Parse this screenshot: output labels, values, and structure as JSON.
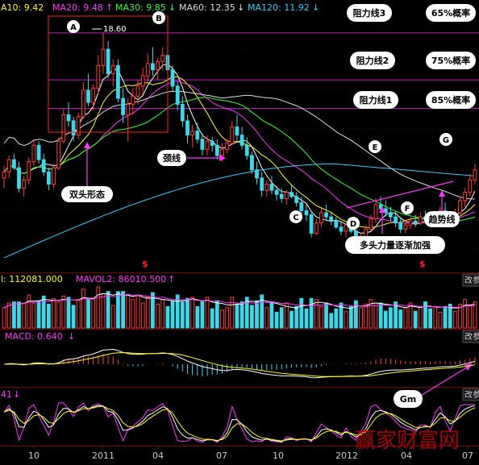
{
  "ma_header": {
    "ma10": "A10: 9.42",
    "ma20": "MA20: 9.48",
    "ma20_arrow": "↑",
    "ma30": "MA30: 9.85",
    "ma30_arrow": "↓",
    "ma60": "MA60: 12.35",
    "ma60_arrow": "↓",
    "ma120": "MA120: 11.92",
    "ma120_arrow": "↓"
  },
  "vol_header": {
    "vol": "l: 112081.000",
    "mavol2": "MAVOL2: 86010.500",
    "arrow": "↑",
    "btn": "改参"
  },
  "macd_header": {
    "macd": "MACD: 0.640",
    "arrow": "↓",
    "btn": "改参"
  },
  "kdj_header": {
    "val": "41",
    "arrow": "↓",
    "btn": "改参"
  },
  "annotations": {
    "A": "A",
    "B": "B",
    "C": "C",
    "D": "D",
    "E": "E",
    "F": "F",
    "G": "G",
    "peak_label": "18.60",
    "double_top": "双头形态",
    "neckline": "颈线",
    "trendline": "趋势线",
    "bull_strength": "多头力量逐渐加强",
    "gm": "Gm",
    "dollar1": "$",
    "dollar2": "$"
  },
  "resistance": [
    {
      "label": "阻力线3",
      "prob": "65%概率"
    },
    {
      "label": "阻力线2",
      "prob": "75%概率"
    },
    {
      "label": "阻力线1",
      "prob": "85%概率"
    }
  ],
  "x_axis": {
    "ticks": [
      "10",
      "2011",
      "04",
      "07",
      "10",
      "2012",
      "04",
      "07"
    ]
  },
  "watermark": "赢家财富网",
  "colors": {
    "up": "#ff3b3b",
    "down": "#3fd7e8",
    "ma5": "#ffffff",
    "ma10": "#ffff00",
    "ma20": "#ff33ff",
    "ma30": "#33ff33",
    "ma60": "#dddddd",
    "ma120": "#33ccff",
    "annot": "#ff33ff"
  },
  "chart_data": {
    "type": "candlestick",
    "price_panel": {
      "ylim": [
        7.2,
        19.5
      ],
      "candles": [
        [
          11.5,
          12.1,
          11.0,
          11.8
        ],
        [
          11.8,
          12.6,
          11.5,
          12.4
        ],
        [
          12.4,
          12.7,
          11.9,
          12.0
        ],
        [
          12.0,
          12.3,
          10.8,
          11.0
        ],
        [
          11.0,
          11.6,
          10.6,
          11.4
        ],
        [
          11.4,
          12.5,
          11.2,
          12.3
        ],
        [
          12.3,
          13.4,
          12.1,
          13.1
        ],
        [
          13.1,
          13.3,
          12.2,
          12.4
        ],
        [
          12.4,
          12.7,
          11.6,
          11.8
        ],
        [
          11.8,
          12.0,
          10.9,
          11.2
        ],
        [
          11.2,
          12.2,
          11.0,
          12.0
        ],
        [
          12.0,
          13.5,
          11.9,
          13.3
        ],
        [
          13.3,
          14.9,
          13.2,
          14.6
        ],
        [
          14.6,
          15.2,
          14.0,
          14.3
        ],
        [
          14.3,
          14.5,
          13.3,
          13.6
        ],
        [
          13.6,
          14.7,
          13.4,
          14.5
        ],
        [
          14.5,
          16.2,
          14.4,
          15.8
        ],
        [
          15.8,
          16.6,
          15.0,
          15.2
        ],
        [
          15.2,
          16.1,
          14.8,
          15.9
        ],
        [
          15.9,
          17.5,
          15.6,
          17.0
        ],
        [
          17.0,
          18.6,
          16.6,
          17.8
        ],
        [
          17.8,
          18.2,
          16.4,
          16.6
        ],
        [
          16.6,
          17.3,
          16.0,
          17.0
        ],
        [
          17.0,
          17.3,
          15.2,
          15.4
        ],
        [
          15.4,
          15.9,
          14.2,
          14.6
        ],
        [
          14.6,
          15.4,
          13.3,
          15.1
        ],
        [
          15.1,
          15.9,
          14.6,
          15.5
        ],
        [
          15.5,
          16.3,
          15.1,
          16.0
        ],
        [
          16.0,
          16.9,
          15.6,
          16.5
        ],
        [
          16.5,
          17.6,
          16.2,
          17.1
        ],
        [
          17.1,
          17.9,
          16.5,
          16.8
        ],
        [
          16.8,
          17.4,
          16.3,
          17.2
        ],
        [
          17.2,
          17.9,
          16.8,
          17.5
        ],
        [
          17.5,
          17.8,
          16.6,
          16.8
        ],
        [
          16.8,
          17.0,
          15.7,
          16.0
        ],
        [
          16.0,
          16.2,
          14.8,
          15.1
        ],
        [
          15.1,
          15.5,
          14.0,
          14.3
        ],
        [
          14.3,
          14.6,
          13.2,
          13.6
        ],
        [
          13.6,
          14.1,
          13.0,
          13.8
        ],
        [
          13.8,
          14.2,
          13.2,
          13.4
        ],
        [
          13.4,
          13.7,
          12.6,
          12.9
        ],
        [
          12.9,
          13.6,
          12.6,
          13.3
        ],
        [
          13.3,
          13.5,
          12.8,
          13.1
        ],
        [
          13.1,
          13.4,
          12.4,
          12.6
        ],
        [
          12.6,
          13.2,
          12.3,
          12.9
        ],
        [
          12.9,
          13.4,
          12.7,
          13.2
        ],
        [
          13.2,
          14.3,
          13.1,
          14.0
        ],
        [
          14.0,
          14.6,
          13.3,
          13.6
        ],
        [
          13.6,
          14.0,
          12.9,
          13.1
        ],
        [
          13.1,
          13.5,
          12.4,
          12.6
        ],
        [
          12.6,
          12.8,
          11.7,
          11.9
        ],
        [
          11.9,
          12.3,
          11.2,
          11.5
        ],
        [
          11.5,
          11.8,
          10.6,
          10.9
        ],
        [
          10.9,
          11.4,
          10.6,
          11.2
        ],
        [
          11.2,
          11.6,
          10.7,
          10.9
        ],
        [
          10.9,
          11.1,
          10.4,
          10.7
        ],
        [
          10.7,
          11.0,
          10.3,
          10.5
        ],
        [
          10.5,
          10.9,
          10.2,
          10.8
        ],
        [
          10.8,
          11.2,
          10.5,
          10.6
        ],
        [
          10.6,
          10.8,
          10.1,
          10.3
        ],
        [
          10.3,
          10.6,
          9.6,
          9.9
        ],
        [
          9.9,
          10.2,
          9.4,
          9.7
        ],
        [
          9.7,
          9.9,
          8.6,
          8.8
        ],
        [
          8.8,
          9.5,
          8.7,
          9.3
        ],
        [
          9.3,
          10.0,
          9.1,
          9.8
        ],
        [
          9.8,
          10.2,
          9.4,
          9.6
        ],
        [
          9.6,
          9.8,
          9.2,
          9.4
        ],
        [
          9.4,
          9.6,
          9.0,
          9.1
        ],
        [
          9.1,
          9.4,
          8.7,
          8.9
        ],
        [
          8.9,
          9.3,
          8.6,
          9.2
        ],
        [
          9.2,
          9.5,
          8.8,
          8.9
        ],
        [
          8.9,
          9.0,
          8.2,
          8.4
        ],
        [
          8.4,
          8.8,
          7.9,
          8.6
        ],
        [
          8.6,
          9.2,
          8.4,
          9.0
        ],
        [
          9.0,
          9.7,
          8.9,
          9.5
        ],
        [
          9.5,
          10.5,
          9.3,
          10.2
        ],
        [
          10.2,
          10.6,
          9.8,
          10.0
        ],
        [
          10.0,
          10.4,
          9.6,
          9.8
        ],
        [
          9.8,
          10.1,
          9.4,
          9.6
        ],
        [
          9.6,
          9.9,
          9.1,
          9.3
        ],
        [
          9.3,
          9.6,
          8.8,
          9.0
        ],
        [
          9.0,
          9.4,
          8.8,
          9.2
        ],
        [
          9.2,
          9.6,
          9.0,
          9.4
        ],
        [
          9.4,
          9.7,
          9.1,
          9.3
        ],
        [
          9.3,
          9.8,
          9.2,
          9.6
        ],
        [
          9.6,
          9.9,
          9.3,
          9.5
        ],
        [
          9.5,
          9.8,
          9.1,
          9.3
        ],
        [
          9.3,
          9.7,
          9.2,
          9.6
        ],
        [
          9.6,
          10.1,
          9.4,
          9.9
        ],
        [
          9.9,
          10.3,
          9.5,
          9.6
        ],
        [
          9.6,
          9.8,
          9.2,
          9.4
        ],
        [
          9.4,
          10.0,
          9.3,
          9.8
        ],
        [
          9.8,
          10.6,
          9.7,
          10.4
        ],
        [
          10.4,
          11.0,
          10.1,
          10.8
        ],
        [
          10.8,
          11.7,
          10.6,
          11.4
        ],
        [
          11.4,
          12.2,
          11.2,
          11.9
        ]
      ],
      "resistance_levels": [
        18.6,
        16.3,
        14.9
      ],
      "neckline_level": 11.2
    },
    "volume_panel": {
      "mavol2": 86010.5,
      "vol": 112081
    },
    "macd_panel": {
      "macd": 0.64
    }
  }
}
